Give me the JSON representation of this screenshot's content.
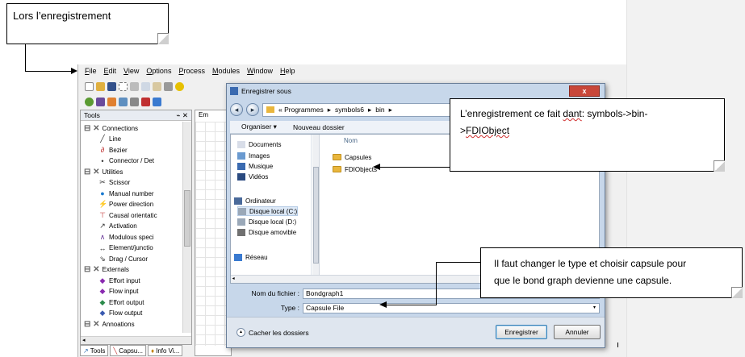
{
  "callouts": {
    "top": "Lors l’enregistrement",
    "path_line1_a": "L’enregistrement ce fait ",
    "path_line1_b": "dant",
    "path_line1_c": ":   symbols->bin-",
    "path_line2": "FDIObject",
    "path_line2_prefix": ">",
    "type_line1": "Il faut changer  le type et choisir capsule pour",
    "type_line2": "que le bond graph  devienne une capsule."
  },
  "app": {
    "menu": [
      "File",
      "Edit",
      "View",
      "Options",
      "Process",
      "Modules",
      "Window",
      "Help"
    ],
    "tools_title": "Tools",
    "tools_pin": "\u0002 x",
    "tools": [
      {
        "label": "Connections",
        "kind": "category",
        "icon": "connections-icon"
      },
      {
        "label": "Line",
        "kind": "item",
        "icon": "line-icon"
      },
      {
        "label": "Bezier",
        "kind": "item",
        "icon": "bezier-icon"
      },
      {
        "label": "Connector / Det",
        "kind": "item",
        "icon": "connector-icon"
      },
      {
        "label": "Utilities",
        "kind": "category",
        "icon": "utilities-icon"
      },
      {
        "label": "Scissor",
        "kind": "item",
        "icon": "scissor-icon"
      },
      {
        "label": "Manual number",
        "kind": "item",
        "icon": "manual-number-icon"
      },
      {
        "label": "Power direction",
        "kind": "item",
        "icon": "power-direction-icon"
      },
      {
        "label": "Causal orientatic",
        "kind": "item",
        "icon": "causal-orientation-icon"
      },
      {
        "label": "Activation",
        "kind": "item",
        "icon": "activation-icon"
      },
      {
        "label": "Modulous speci",
        "kind": "item",
        "icon": "modulous-icon"
      },
      {
        "label": "Element/junctio",
        "kind": "item",
        "icon": "element-junction-icon"
      },
      {
        "label": "Drag / Cursor",
        "kind": "item",
        "icon": "drag-cursor-icon"
      },
      {
        "label": "Externals",
        "kind": "category",
        "icon": "externals-icon"
      },
      {
        "label": "Effort input",
        "kind": "item",
        "icon": "effort-input-icon"
      },
      {
        "label": "Flow input",
        "kind": "item",
        "icon": "flow-input-icon"
      },
      {
        "label": "Effort output",
        "kind": "item",
        "icon": "effort-output-icon"
      },
      {
        "label": "Flow output",
        "kind": "item",
        "icon": "flow-output-icon"
      },
      {
        "label": "Annoations",
        "kind": "category",
        "icon": "annotations-icon"
      }
    ],
    "bottom_tabs": [
      "Tools",
      "Capsu...",
      "Info Vi..."
    ],
    "workspace_tab": "Em"
  },
  "dialog": {
    "title": "Enregistrer sous",
    "close": "x",
    "breadcrumb": [
      "«  Programmes",
      "symbols6",
      "bin"
    ],
    "organize": "Organiser ▾",
    "new_folder": "Nouveau dossier",
    "nav": [
      {
        "label": "Documents",
        "icon": "documents-icon"
      },
      {
        "label": "Images",
        "icon": "images-icon"
      },
      {
        "label": "Musique",
        "icon": "music-icon"
      },
      {
        "label": "Vidéos",
        "icon": "videos-icon"
      },
      {
        "label": "Ordinateur",
        "icon": "computer-icon"
      },
      {
        "label": "Disque local (C:)",
        "icon": "drive-icon",
        "selected": true
      },
      {
        "label": "Disque local (D:)",
        "icon": "drive-icon"
      },
      {
        "label": "Disque amovible",
        "icon": "removable-drive-icon"
      },
      {
        "label": "Réseau",
        "icon": "network-icon"
      }
    ],
    "column_name": "Nom",
    "folders": [
      "Capsules",
      "FDIObjects"
    ],
    "filename_label": "Nom du fichier :",
    "filename_value": "Bondgraph1",
    "type_label": "Type :",
    "type_value": "Capsule File",
    "hide_folders": "Cacher les dossiers",
    "save": "Enregistrer",
    "cancel": "Annuler"
  },
  "colors": {
    "accent": "#3c7fb1",
    "dialog_frame": "#c7d7ea",
    "close": "#c8473a",
    "folder": "#e9b63d"
  }
}
